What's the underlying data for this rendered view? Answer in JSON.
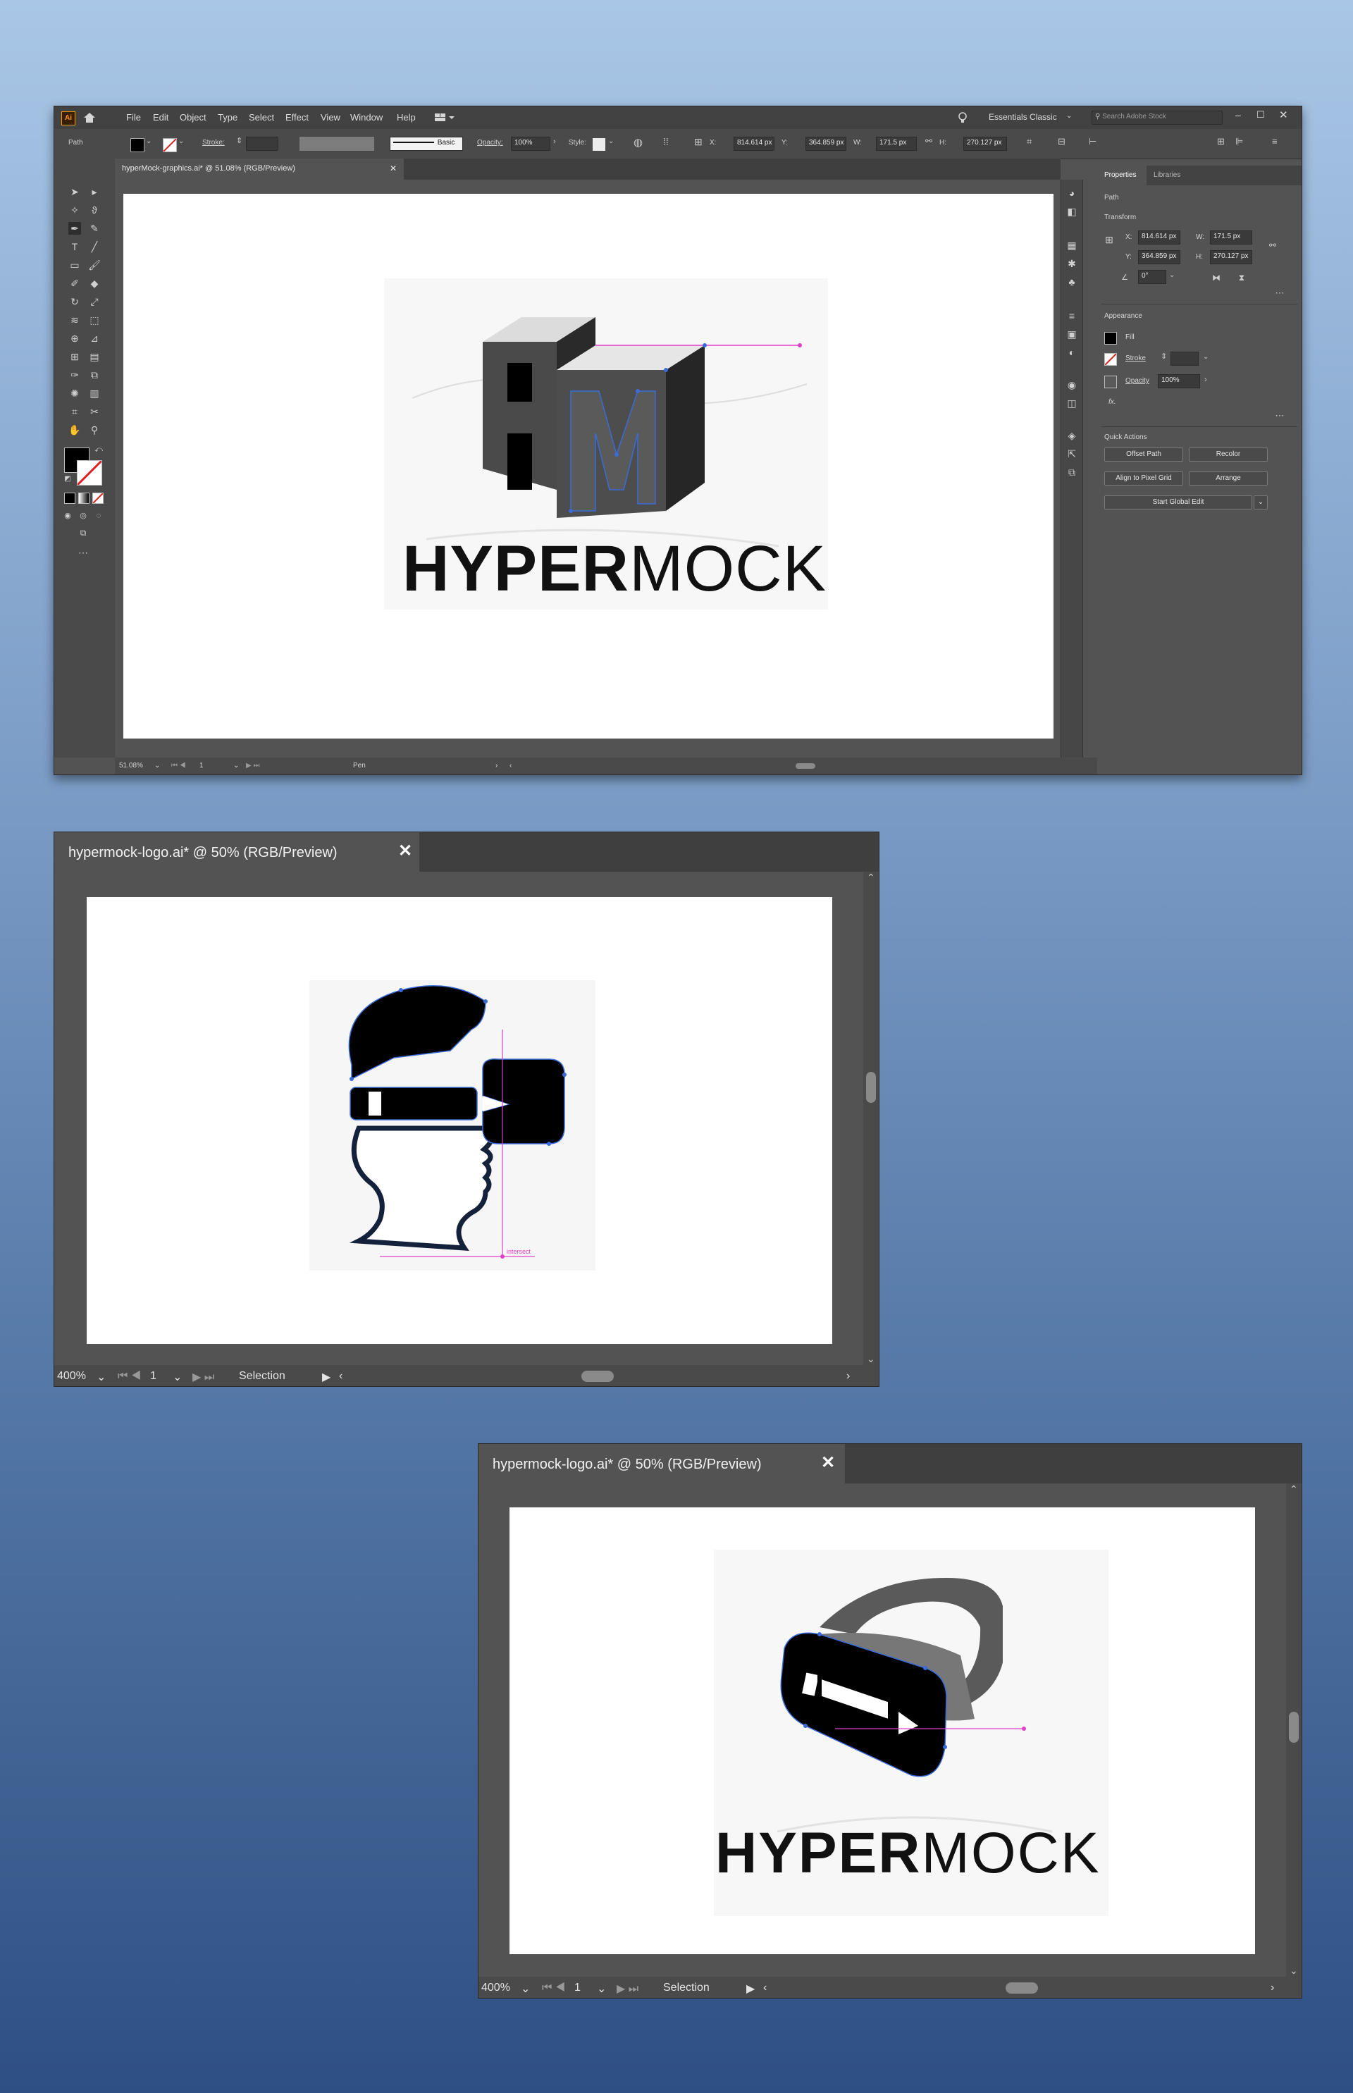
{
  "main_window": {
    "menu": [
      "File",
      "Edit",
      "Object",
      "Type",
      "Select",
      "Effect",
      "View",
      "Window",
      "Help"
    ],
    "workspace": "Essentials Classic",
    "search_placeholder": "Search Adobe Stock",
    "control": {
      "selection_type": "Path",
      "stroke_label": "Stroke:",
      "brush": "Basic",
      "opacity_label": "Opacity:",
      "opacity_value": "100%",
      "style_label": "Style:",
      "x_label": "X:",
      "x_value": "814.614 px",
      "y_label": "Y:",
      "y_value": "364.859 px",
      "w_label": "W:",
      "w_value": "171.5 px",
      "h_label": "H:",
      "h_value": "270.127 px"
    },
    "doc_tab": "hyperMock-graphics.ai* @ 51.08% (RGB/Preview)",
    "logo": {
      "bold": "HYPER",
      "light": "MOCK"
    },
    "status": {
      "zoom": "51.08%",
      "page": "1",
      "tool": "Pen"
    },
    "properties": {
      "tabs": [
        "Properties",
        "Libraries"
      ],
      "section": "Path",
      "transform_title": "Transform",
      "x_label": "X:",
      "x_value": "814.614 px",
      "y_label": "Y:",
      "y_value": "364.859 px",
      "w_label": "W:",
      "w_value": "171.5 px",
      "h_label": "H:",
      "h_value": "270.127 px",
      "angle_value": "0°",
      "appearance_title": "Appearance",
      "fill_label": "Fill",
      "stroke_label": "Stroke",
      "opacity_label": "Opacity",
      "opacity_value": "100%",
      "fx": "fx.",
      "quick_actions_title": "Quick Actions",
      "buttons": [
        "Offset Path",
        "Recolor",
        "Align to Pixel Grid",
        "Arrange",
        "Start Global Edit"
      ]
    }
  },
  "window2": {
    "tab": "hypermock-logo.ai* @ 50% (RGB/Preview)",
    "close": "✕",
    "status": {
      "zoom": "400%",
      "page": "1",
      "tool": "Selection"
    },
    "annotation": "intersect"
  },
  "window3": {
    "tab": "hypermock-logo.ai* @ 50% (RGB/Preview)",
    "close": "✕",
    "status": {
      "zoom": "400%",
      "page": "1",
      "tool": "Selection"
    },
    "logo": {
      "bold": "HYPER",
      "light": "MOCK"
    }
  },
  "colors": {
    "accent_magenta": "#e040c8",
    "anchor_blue": "#3a6bd8",
    "ui_dark": "#535353"
  }
}
